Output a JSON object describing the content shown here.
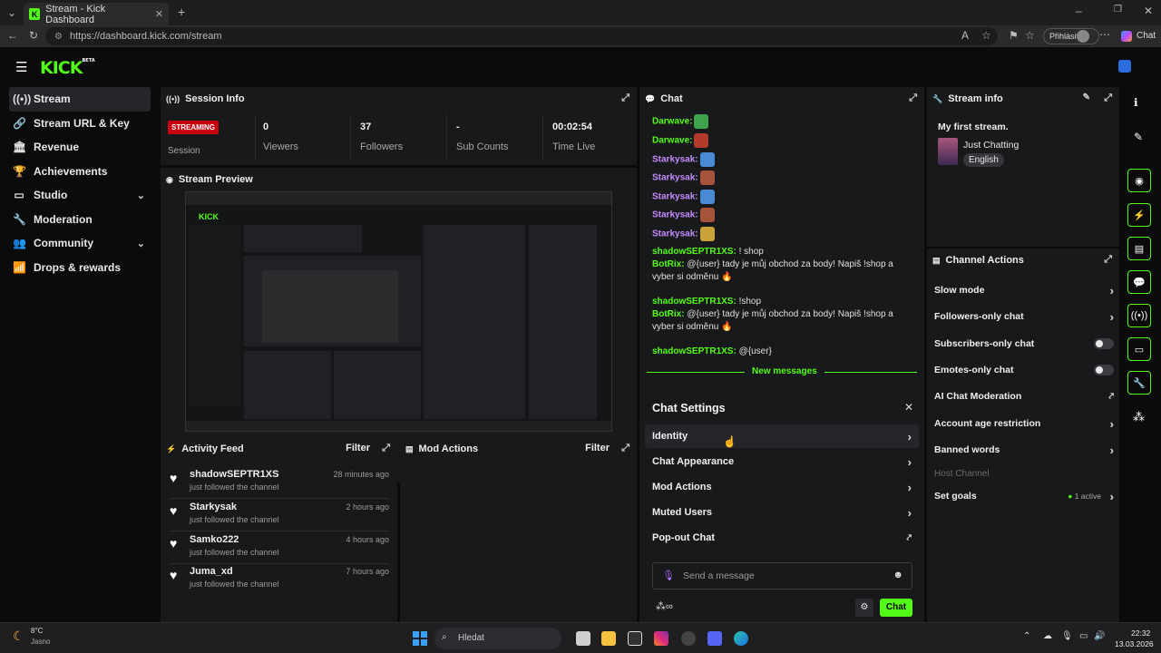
{
  "browser": {
    "tab_title": "Stream - Kick Dashboard",
    "url": "https://dashboard.kick.com/stream",
    "profile_label": "Přihlásit",
    "chat_label": "Chat"
  },
  "app": {
    "logo": "KICK",
    "logo_badge": "BETA"
  },
  "sidebar": {
    "items": [
      {
        "label": "Stream",
        "icon": "broadcast-icon"
      },
      {
        "label": "Stream URL & Key",
        "icon": "link-icon"
      },
      {
        "label": "Revenue",
        "icon": "bank-icon"
      },
      {
        "label": "Achievements",
        "icon": "trophy-icon"
      },
      {
        "label": "Studio",
        "icon": "studio-icon"
      },
      {
        "label": "Moderation",
        "icon": "wrench-icon"
      },
      {
        "label": "Community",
        "icon": "people-icon"
      },
      {
        "label": "Drops & rewards",
        "icon": "chart-icon"
      }
    ]
  },
  "session": {
    "title": "Session Info",
    "badge": "STREAMING",
    "session_label": "Session",
    "stats": [
      {
        "value": "0",
        "label": "Viewers"
      },
      {
        "value": "37",
        "label": "Followers"
      },
      {
        "value": "-",
        "label": "Sub Counts"
      },
      {
        "value": "00:02:54",
        "label": "Time Live"
      }
    ]
  },
  "preview": {
    "title": "Stream Preview"
  },
  "activity": {
    "title": "Activity Feed",
    "filter": "Filter",
    "items": [
      {
        "name": "shadowSEPTR1XS",
        "time": "28 minutes ago",
        "sub": "just followed the channel"
      },
      {
        "name": "Starkysak",
        "time": "2 hours ago",
        "sub": "just followed the channel"
      },
      {
        "name": "Samko222",
        "time": "4 hours ago",
        "sub": "just followed the channel"
      },
      {
        "name": "Juma_xd",
        "time": "7 hours ago",
        "sub": "just followed the channel"
      }
    ]
  },
  "modactions": {
    "title": "Mod Actions",
    "filter": "Filter"
  },
  "chat": {
    "title": "Chat",
    "messages": [
      {
        "user": "Darwave:",
        "color": "#53fc18",
        "text": "",
        "emote": "#3fa34d"
      },
      {
        "user": "Darwave:",
        "color": "#53fc18",
        "text": "",
        "emote": "#b23b2c"
      },
      {
        "user": "Starkysak:",
        "color": "#c48bff",
        "text": "",
        "emote": "#4a8ad4"
      },
      {
        "user": "Starkysak:",
        "color": "#c48bff",
        "text": "",
        "emote": "#a5533a"
      },
      {
        "user": "Starkysak:",
        "color": "#c48bff",
        "text": "",
        "emote": "#4a8ad4"
      },
      {
        "user": "Starkysak:",
        "color": "#c48bff",
        "text": "",
        "emote": "#a5533a"
      },
      {
        "user": "Starkysak:",
        "color": "#c48bff",
        "text": "",
        "emote": "#c9a23a"
      },
      {
        "user": "shadowSEPTR1XS:",
        "color": "#53fc18",
        "text": "! shop"
      },
      {
        "user": "BotRix:",
        "color": "#53fc18",
        "text": "@{user} tady je můj obchod za body! Napiš !shop a vyber si odměnu 🔥"
      },
      {
        "user": "shadowSEPTR1XS:",
        "color": "#53fc18",
        "text": "!shop"
      },
      {
        "user": "BotRix:",
        "color": "#53fc18",
        "text": "@{user} tady je můj obchod za body! Napiš !shop a vyber si odměnu 🔥"
      },
      {
        "user": "shadowSEPTR1XS:",
        "color": "#53fc18",
        "text": "@{user}"
      }
    ],
    "new_messages": "New messages",
    "settings_title": "Chat Settings",
    "settings": [
      "Identity",
      "Chat Appearance",
      "Mod Actions",
      "Muted Users",
      "Pop-out Chat"
    ],
    "input_placeholder": "Send a message",
    "send_label": "Chat"
  },
  "streaminfo": {
    "title": "Stream info",
    "stream_title": "My first stream.",
    "category": "Just Chatting",
    "language": "English"
  },
  "channelactions": {
    "title": "Channel Actions",
    "items": [
      {
        "label": "Slow mode",
        "control": "arrow"
      },
      {
        "label": "Followers-only chat",
        "control": "arrow"
      },
      {
        "label": "Subscribers-only chat",
        "control": "toggle"
      },
      {
        "label": "Emotes-only chat",
        "control": "toggle"
      },
      {
        "label": "AI Chat Moderation",
        "control": "external"
      },
      {
        "label": "Account age restriction",
        "control": "arrow"
      },
      {
        "label": "Banned words",
        "control": "arrow"
      },
      {
        "label": "Host Channel",
        "control": "none"
      },
      {
        "label": "Set goals",
        "control": "arrow",
        "status": "1 active"
      }
    ]
  },
  "taskbar": {
    "weather_temp": "8°C",
    "weather_text": "Jasno",
    "search": "Hledat",
    "time": "22:32",
    "date": "13.03.2026"
  },
  "colors": {
    "accent": "#53fc18",
    "panel": "#18191b",
    "badge": "#c90010"
  }
}
